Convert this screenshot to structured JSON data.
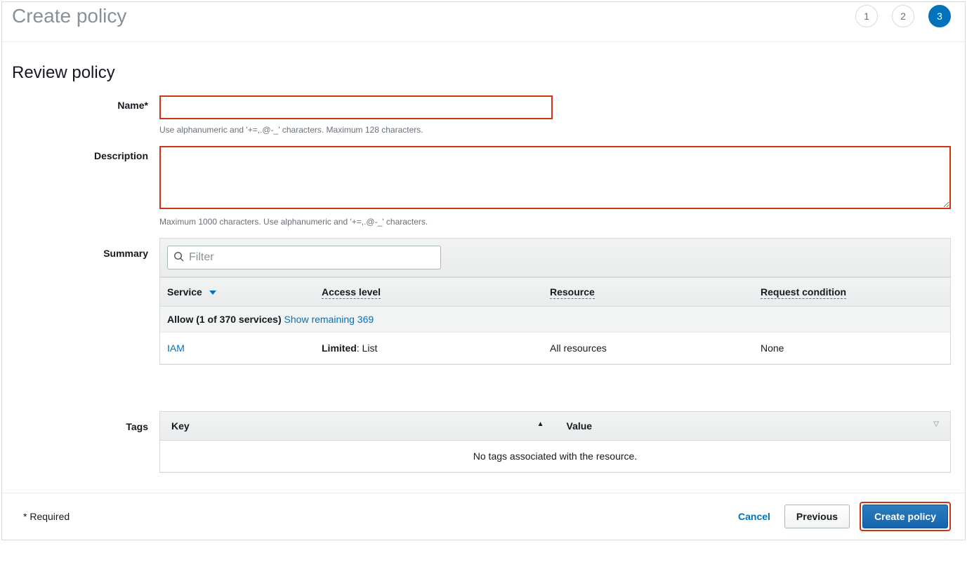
{
  "header": {
    "title": "Create policy",
    "steps": [
      "1",
      "2",
      "3"
    ],
    "active_step_index": 2
  },
  "section": {
    "title": "Review policy"
  },
  "form": {
    "name_label": "Name*",
    "name_value": "",
    "name_hint": "Use alphanumeric and '+=,.@-_' characters. Maximum 128 characters.",
    "description_label": "Description",
    "description_value": "",
    "description_hint": "Maximum 1000 characters. Use alphanumeric and '+=,.@-_' characters.",
    "summary_label": "Summary",
    "tags_label": "Tags"
  },
  "summary": {
    "filter_placeholder": "Filter",
    "columns": {
      "service": "Service",
      "access_level": "Access level",
      "resource": "Resource",
      "request_condition": "Request condition"
    },
    "allow_row": {
      "prefix": "Allow (1 of 370 services) ",
      "link": "Show remaining 369"
    },
    "rows": [
      {
        "service": "IAM",
        "access_level_bold": "Limited",
        "access_level_rest": ": List",
        "resource": "All resources",
        "request_condition": "None"
      }
    ]
  },
  "tags": {
    "columns": {
      "key": "Key",
      "value": "Value"
    },
    "empty": "No tags associated with the resource."
  },
  "footer": {
    "required": "* Required",
    "cancel": "Cancel",
    "previous": "Previous",
    "create": "Create policy"
  }
}
